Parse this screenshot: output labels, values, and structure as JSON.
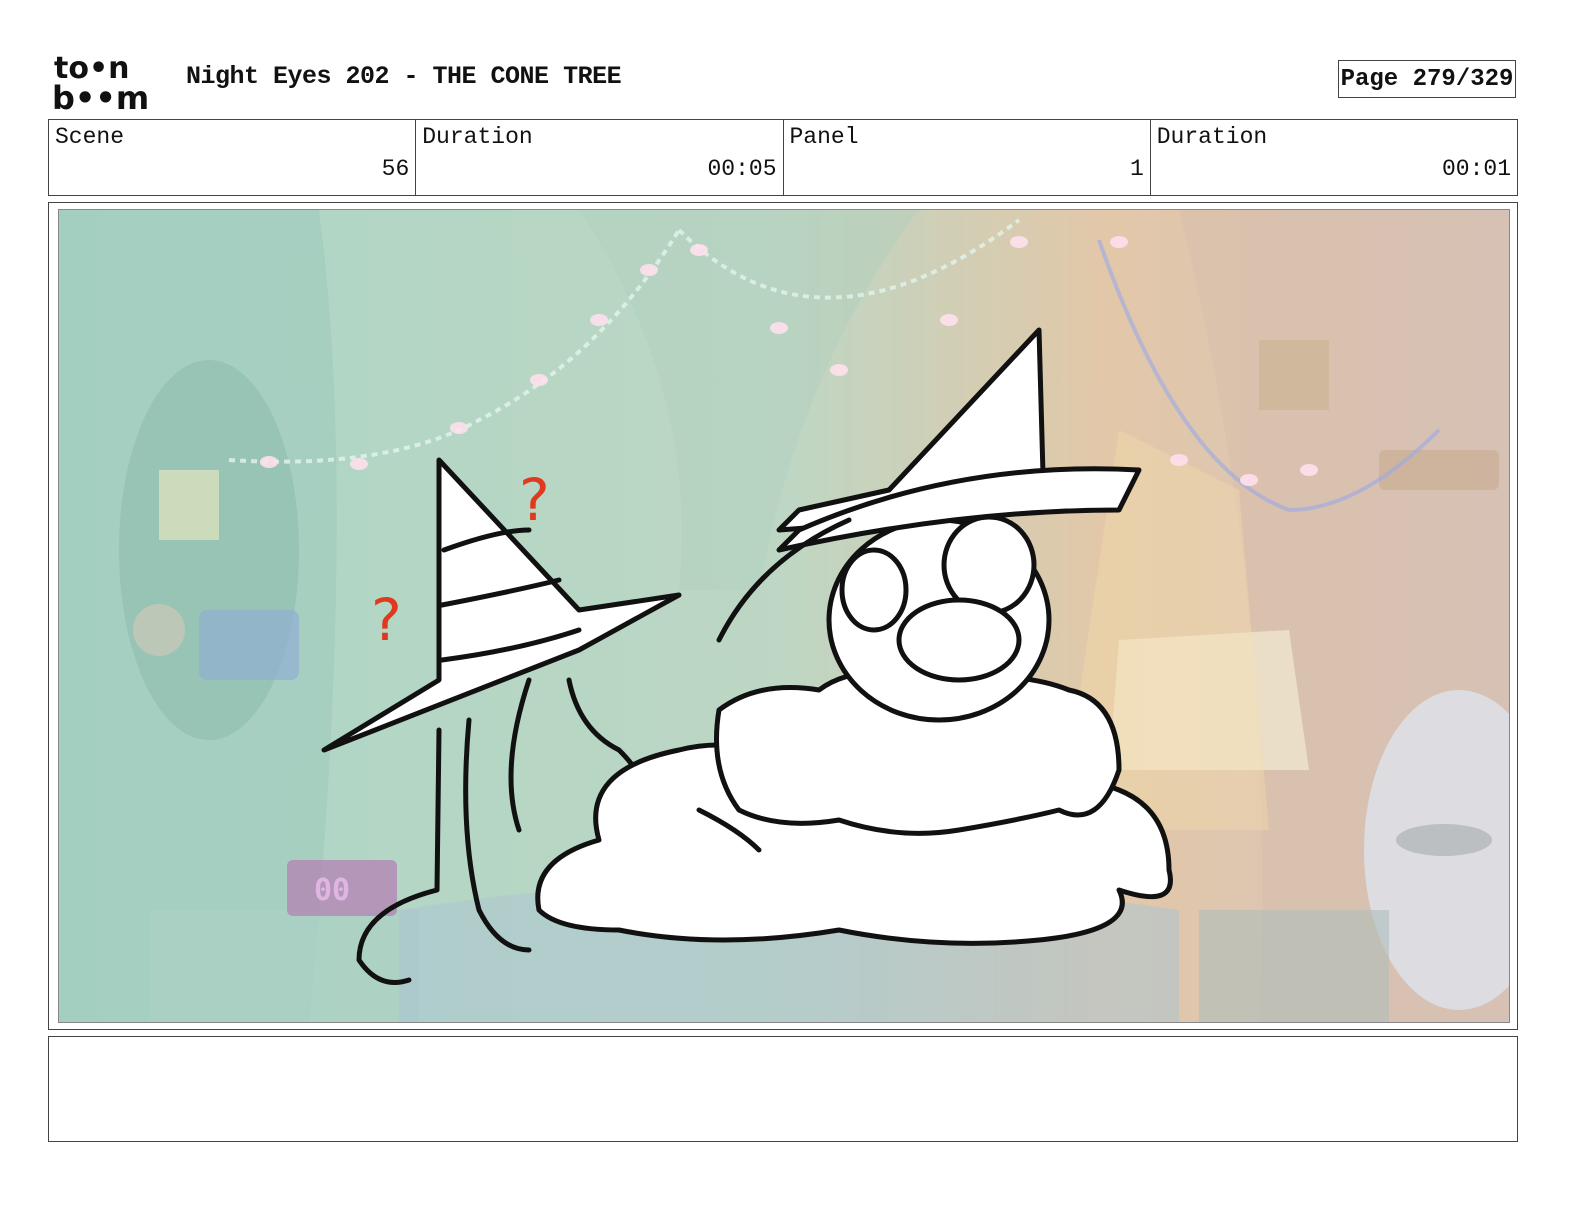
{
  "header": {
    "logo_top": "to•n",
    "logo_bottom": "b••m",
    "title": "Night Eyes 202 - THE CONE TREE",
    "page": "Page 279/329"
  },
  "info": {
    "scene_label": "Scene",
    "scene_value": "56",
    "duration_label": "Duration",
    "duration_value": "00:05",
    "panel_label": "Panel",
    "panel_value": "1",
    "panel_duration_label": "Duration",
    "panel_duration_value": "00:01"
  },
  "panel": {
    "clock_text": "00",
    "mark_1": "?",
    "mark_2": "?"
  },
  "notes": {
    "text": ""
  },
  "colors": {
    "border": "#444444",
    "question_marks": "#e03a1e",
    "bg_left": "#8fc9b4",
    "bg_right": "#d9b58c"
  }
}
